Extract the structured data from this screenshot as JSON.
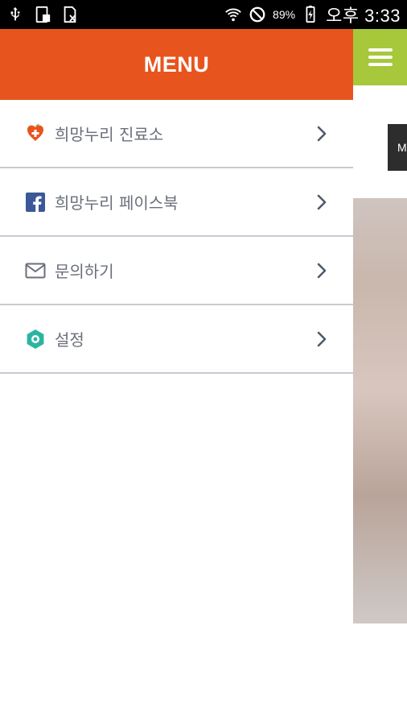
{
  "status_bar": {
    "battery_percent": "89%",
    "time": "오후 3:33",
    "icons": [
      "usb-icon",
      "device-icon",
      "document-icon",
      "wifi-icon",
      "do-not-disturb-icon",
      "battery-icon"
    ]
  },
  "drawer": {
    "title": "MENU",
    "items": [
      {
        "label": "희망누리 진료소",
        "icon": "clinic-heart-icon"
      },
      {
        "label": "희망누리 페이스북",
        "icon": "facebook-icon"
      },
      {
        "label": "문의하기",
        "icon": "mail-icon"
      },
      {
        "label": "설정",
        "icon": "settings-gear-icon"
      }
    ]
  },
  "background_page": {
    "chip_text": "M"
  },
  "colors": {
    "header": "#e8541e",
    "hamburger_bg": "#a6c83a",
    "divider": "#c7cbd1",
    "label": "#6a6f7a",
    "chevron": "#4f5b6b"
  }
}
